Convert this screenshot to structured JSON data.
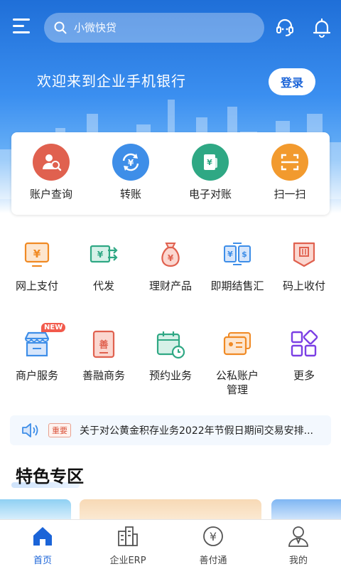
{
  "header": {
    "search_placeholder": "小微快贷",
    "welcome_text": "欢迎来到企业手机银行",
    "login_label": "登录"
  },
  "quick_actions": [
    {
      "label": "账户查询",
      "icon": "account-query-icon",
      "color": "#e0614f"
    },
    {
      "label": "转账",
      "icon": "transfer-icon",
      "color": "#3e8ee8"
    },
    {
      "label": "电子对账",
      "icon": "e-reconciliation-icon",
      "color": "#2fa884"
    },
    {
      "label": "扫一扫",
      "icon": "scan-icon",
      "color": "#f29a2e"
    }
  ],
  "services_row1": [
    {
      "label": "网上支付",
      "icon": "online-payment-icon"
    },
    {
      "label": "代发",
      "icon": "payroll-icon"
    },
    {
      "label": "理财产品",
      "icon": "wealth-product-icon"
    },
    {
      "label": "即期结售汇",
      "icon": "fx-settlement-icon"
    },
    {
      "label": "码上收付",
      "icon": "qr-collect-icon"
    }
  ],
  "services_row2": [
    {
      "label": "商户服务",
      "icon": "merchant-icon",
      "badge": "NEW"
    },
    {
      "label": "善融商务",
      "icon": "shanrong-icon"
    },
    {
      "label": "预约业务",
      "icon": "appointment-icon"
    },
    {
      "label": "公私账户\n管理",
      "icon": "account-management-icon"
    },
    {
      "label": "更多",
      "icon": "more-icon"
    }
  ],
  "notice": {
    "tag": "重要",
    "text": "关于对公黄金积存业务2022年节假日期间交易安排..."
  },
  "section": {
    "title": "特色专区"
  },
  "tabbar": [
    {
      "label": "首页",
      "icon": "home-icon",
      "active": true
    },
    {
      "label": "企业ERP",
      "icon": "erp-icon",
      "active": false
    },
    {
      "label": "善付通",
      "icon": "shanfutong-icon",
      "active": false
    },
    {
      "label": "我的",
      "icon": "profile-icon",
      "active": false
    }
  ],
  "colors": {
    "primary": "#1b64d8",
    "icon_orange": "#f08a24",
    "icon_green": "#2fa884",
    "icon_red": "#e0614f",
    "icon_purple": "#7b3fe4"
  }
}
